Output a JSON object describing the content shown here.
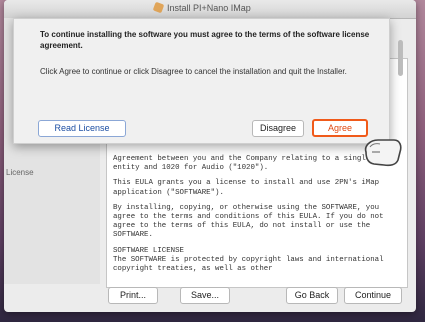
{
  "window": {
    "title": "Install PI+Nano IMap"
  },
  "sidebar": {
    "section_label": "License"
  },
  "license_paragraphs": [
    "Agreement between you and the Company relating to a single entity and 1020 for Audio (\"1020\").",
    "This EULA grants you a license to install and use 2PN's iMap application (\"SOFTWARE\").",
    "By installing, copying, or otherwise using the SOFTWARE, you agree to the terms and conditions of this EULA. If you do not agree to the terms of this EULA, do not install or use the SOFTWARE.",
    "SOFTWARE LICENSE\nThe SOFTWARE is protected by copyright laws and international copyright treaties, as well as other"
  ],
  "buttons": {
    "print": "Print...",
    "save": "Save...",
    "go_back": "Go Back",
    "continue": "Continue"
  },
  "sheet": {
    "title": "To continue installing the software you must agree to the terms of the software license agreement.",
    "body": "Click Agree to continue or click Disagree to cancel the installation and quit the Installer.",
    "read_license": "Read License",
    "disagree": "Disagree",
    "agree": "Agree"
  },
  "colors": {
    "highlight": "#f05a1a"
  }
}
